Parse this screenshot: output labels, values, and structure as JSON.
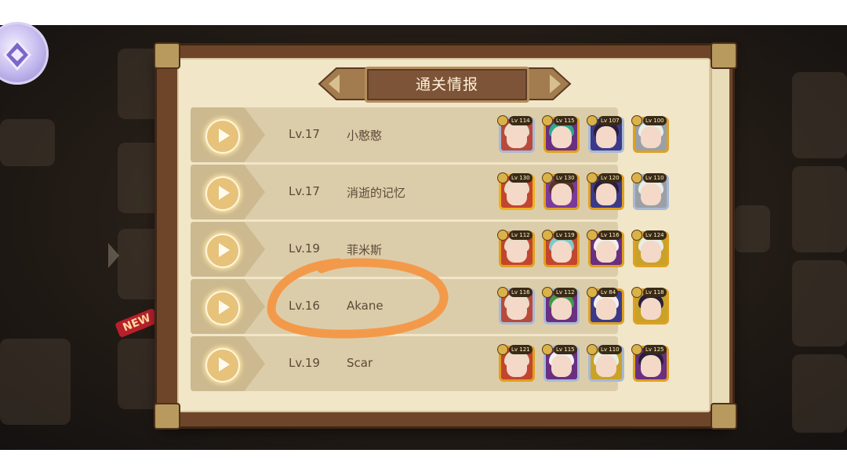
{
  "panel": {
    "title": "通关情报"
  },
  "records": [
    {
      "level": "Lv.17",
      "name": "小憨憨",
      "team": [
        {
          "lv": "Lv 114",
          "frame": "#a8b9d6",
          "bg": "#b84a3c",
          "hair": "#e9dcc9"
        },
        {
          "lv": "Lv 115",
          "frame": "#e0a020",
          "bg": "#6a2f80",
          "hair": "#2fa88c"
        },
        {
          "lv": "Lv 107",
          "frame": "#a8b9d6",
          "bg": "#3b3a8a",
          "hair": "#2a1e3a"
        },
        {
          "lv": "Lv 100",
          "frame": "#e0a020",
          "bg": "#9aa0a6",
          "hair": "#e6efe6"
        }
      ]
    },
    {
      "level": "Lv.17",
      "name": "消逝的记忆",
      "team": [
        {
          "lv": "Lv 130",
          "frame": "#f0b020",
          "bg": "#c2452e",
          "hair": "#e9dcc9"
        },
        {
          "lv": "Lv 130",
          "frame": "#e0a020",
          "bg": "#7a3a9a",
          "hair": "#5a3426"
        },
        {
          "lv": "Lv 120",
          "frame": "#e0a020",
          "bg": "#3b3a8a",
          "hair": "#2a1e3a"
        },
        {
          "lv": "Lv 110",
          "frame": "#a8b9d6",
          "bg": "#9aa0a6",
          "hair": "#e6efe6"
        }
      ]
    },
    {
      "level": "Lv.19",
      "name": "菲米斯",
      "team": [
        {
          "lv": "Lv 112",
          "frame": "#e0a020",
          "bg": "#c2452e",
          "hair": "#e9dcc9"
        },
        {
          "lv": "Lv 119",
          "frame": "#e0a020",
          "bg": "#c2452e",
          "hair": "#7fc8c8"
        },
        {
          "lv": "Lv 116",
          "frame": "#e0a020",
          "bg": "#6a2f80",
          "hair": "#f0f0f0"
        },
        {
          "lv": "Lv 124",
          "frame": "#e0a020",
          "bg": "#c9a22a",
          "hair": "#e6efe6"
        }
      ]
    },
    {
      "level": "Lv.16",
      "name": "Akane",
      "team": [
        {
          "lv": "Lv 116",
          "frame": "#a8b9d6",
          "bg": "#b84a3c",
          "hair": "#e9dcc9"
        },
        {
          "lv": "Lv 112",
          "frame": "#a8b9d6",
          "bg": "#6a2f80",
          "hair": "#3f9b4a"
        },
        {
          "lv": "Lv 84",
          "frame": "#e0a020",
          "bg": "#3b3a8a",
          "hair": "#f0f0f0"
        },
        {
          "lv": "Lv 118",
          "frame": "#e0a020",
          "bg": "#c9a22a",
          "hair": "#2a1e3a"
        }
      ]
    },
    {
      "level": "Lv.19",
      "name": "Scar",
      "team": [
        {
          "lv": "Lv 121",
          "frame": "#e0a020",
          "bg": "#c2452e",
          "hair": "#e9dcc9"
        },
        {
          "lv": "Lv 115",
          "frame": "#a8b9d6",
          "bg": "#6a2f80",
          "hair": "#f0f0f0"
        },
        {
          "lv": "Lv 110",
          "frame": "#a8b9d6",
          "bg": "#c9a22a",
          "hair": "#e6efe6"
        },
        {
          "lv": "Lv 125",
          "frame": "#e0a020",
          "bg": "#6a2f80",
          "hair": "#2a1e3a"
        }
      ]
    }
  ],
  "background": {
    "new_tag": "NEW"
  },
  "annotation": {
    "color": "#f39a4a"
  }
}
